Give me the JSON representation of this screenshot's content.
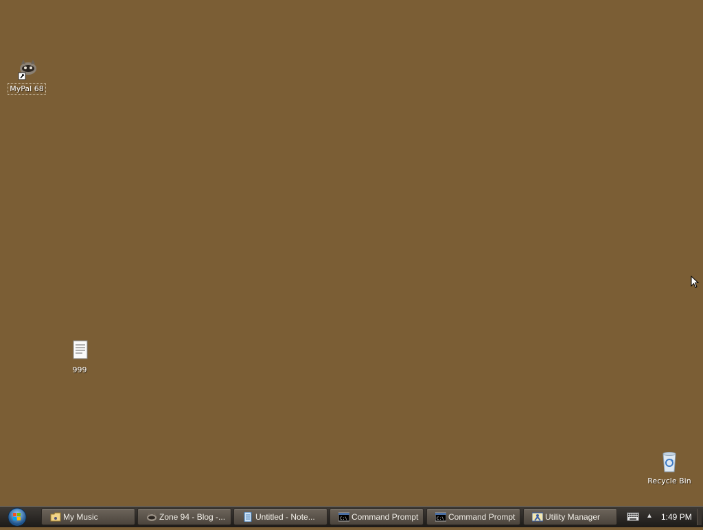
{
  "desktop": {
    "background_color": "#7b5e35",
    "icons": [
      {
        "label": "MyPal 68",
        "icon": "mypal-raccoon-icon",
        "selected": true
      },
      {
        "label": "999",
        "icon": "text-document-icon"
      },
      {
        "label": "Recycle Bin",
        "icon": "recycle-bin-icon"
      }
    ]
  },
  "taskbar": {
    "start_icon": "windows-start-orb-icon",
    "buttons": [
      {
        "label": "My Music",
        "icon": "folder-icon"
      },
      {
        "label": "Zone 94 - Blog -...",
        "icon": "mypal-raccoon-icon"
      },
      {
        "label": "Untitled - Note...",
        "icon": "notepad-icon"
      },
      {
        "label": "Command Prompt",
        "icon": "command-prompt-icon"
      },
      {
        "label": "Command Prompt",
        "icon": "command-prompt-icon"
      },
      {
        "label": "Utility Manager",
        "icon": "utility-manager-icon"
      }
    ],
    "tray": {
      "keyboard_icon": "keyboard-icon",
      "show_hidden_icon": "chevron-up-icon",
      "clock": "1:49 PM"
    }
  }
}
